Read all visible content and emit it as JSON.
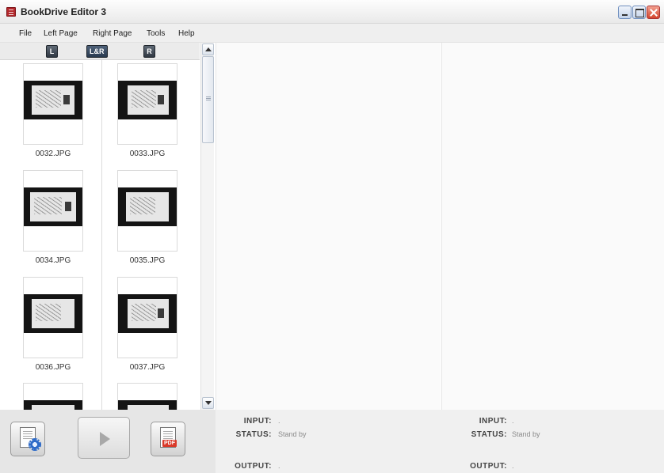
{
  "window": {
    "title": "BookDrive Editor 3"
  },
  "menu": [
    "File",
    "Left Page",
    "Right Page",
    "Tools",
    "Help"
  ],
  "toggles": {
    "left": "L",
    "both": "L&R",
    "right": "R"
  },
  "thumbnails": {
    "left_column": [
      "0032.JPG",
      "0034.JPG",
      "0036.JPG"
    ],
    "right_column": [
      "0033.JPG",
      "0035.JPG",
      "0037.JPG"
    ]
  },
  "actions": {
    "settings_icon": "document-settings-icon",
    "play_icon": "play-icon",
    "pdf_icon": "pdf-icon",
    "pdf_badge": "PDF"
  },
  "left_info": {
    "input_label": "INPUT:",
    "input_value": ".",
    "status_label": "STATUS:",
    "status_value": "Stand by",
    "output_label": "OUTPUT:",
    "output_value": "."
  },
  "right_info": {
    "input_label": "INPUT:",
    "input_value": ".",
    "status_label": "STATUS:",
    "status_value": "Stand by",
    "output_label": "OUTPUT:",
    "output_value": "."
  },
  "colors": {
    "titlebar_bg": "#f5f5f5",
    "menu_bg": "#efefef",
    "toggle_bg": "#3c4551",
    "pane_bg": "#fafafa",
    "close_button": "#d3442d"
  }
}
